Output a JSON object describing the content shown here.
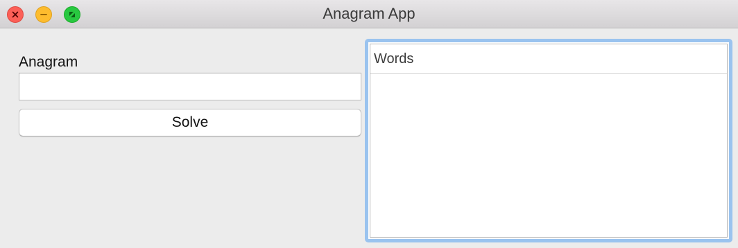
{
  "window": {
    "title": "Anagram App"
  },
  "form": {
    "anagram_label": "Anagram",
    "anagram_value": "",
    "solve_label": "Solve"
  },
  "words": {
    "header": "Words",
    "items": []
  },
  "colors": {
    "close": "#fc5f57",
    "minimize": "#fdbc2e",
    "zoom": "#28c840",
    "focus_ring": "#9ac3ef"
  }
}
